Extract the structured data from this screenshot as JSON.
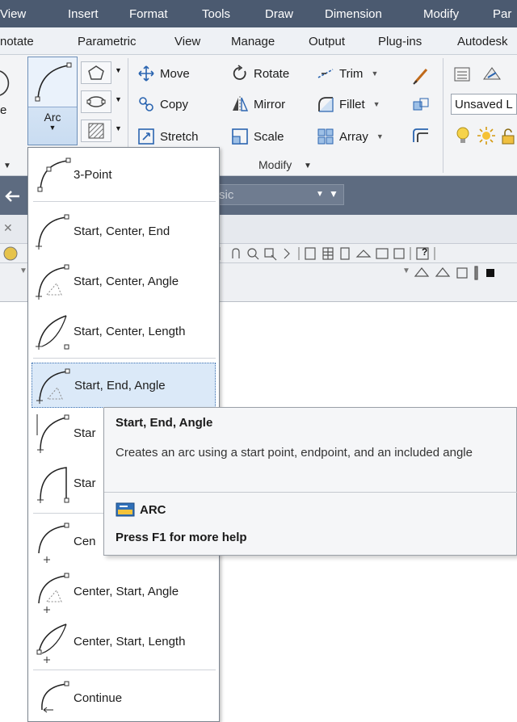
{
  "menubar": [
    "View",
    "Insert",
    "Format",
    "Tools",
    "Draw",
    "Dimension",
    "Modify",
    "Par"
  ],
  "tabs": [
    "notate",
    "Parametric",
    "View",
    "Manage",
    "Output",
    "Plug-ins",
    "Autodesk"
  ],
  "ribbon": {
    "left_partial": "e",
    "arc_label": "Arc",
    "modify_buttons": {
      "move": "Move",
      "copy": "Copy",
      "stretch": "Stretch",
      "rotate": "Rotate",
      "mirror": "Mirror",
      "scale": "Scale",
      "trim": "Trim",
      "fillet": "Fillet",
      "array": "Array"
    },
    "modify_panel_label": "Modify",
    "layer_combo": "Unsaved L"
  },
  "toolbar": {
    "combo_partial": "sic"
  },
  "arc_menu": {
    "items": [
      "3-Point",
      "Start, Center, End",
      "Start, Center, Angle",
      "Start, Center, Length",
      "Start, End, Angle",
      "Star",
      "Star",
      "Cen",
      "Center, Start, Angle",
      "Center, Start, Length",
      "Continue"
    ]
  },
  "tooltip": {
    "title": "Start, End, Angle",
    "description": "Creates an arc using a start point, endpoint, and an included angle",
    "command": "ARC",
    "help": "Press F1 for more help"
  },
  "colors": {
    "menubar_bg": "#4b5a70",
    "highlight_bg": "#dbe9f8",
    "highlight_border": "#3a6fb0"
  }
}
